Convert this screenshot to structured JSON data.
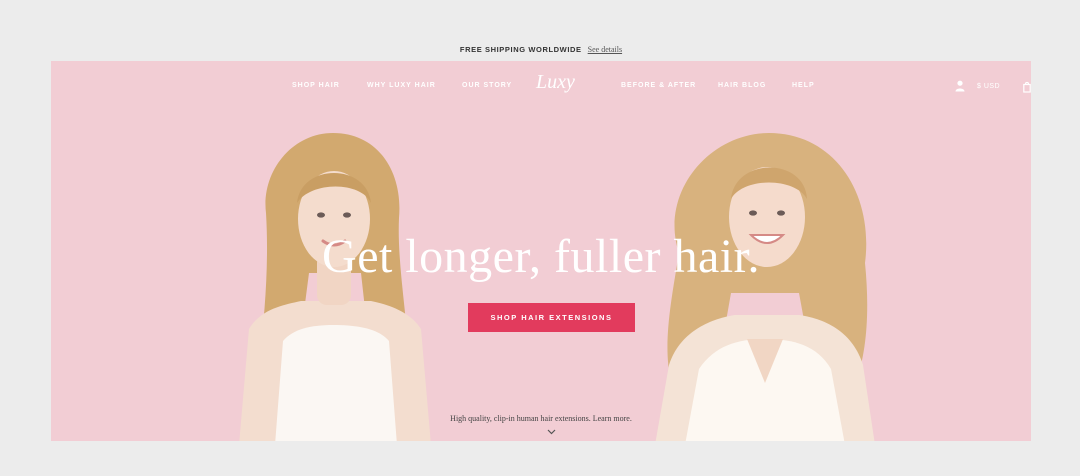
{
  "announcement": {
    "shipping_text": "FREE SHIPPING WORLDWIDE",
    "details_link": "See details"
  },
  "nav": {
    "items": [
      {
        "label": "SHOP HAIR"
      },
      {
        "label": "WHY LUXY HAIR"
      },
      {
        "label": "OUR STORY"
      },
      {
        "label": "BEFORE & AFTER"
      },
      {
        "label": "HAIR BLOG"
      },
      {
        "label": "HELP"
      }
    ],
    "logo_text": "Luxy",
    "cart_total": "$ USD"
  },
  "hero": {
    "headline": "Get longer, fuller hair.",
    "cta_label": "SHOP HAIR EXTENSIONS",
    "subtext": "High quality, clip-in human hair extensions. Learn more."
  },
  "icons": {
    "account": "user-icon",
    "bag": "bag-icon",
    "scroll": "chevron-down-icon"
  },
  "colors": {
    "hero_background": "#f2cdd4",
    "cta_background": "#e23b5d",
    "topbar_background": "#ececec"
  }
}
